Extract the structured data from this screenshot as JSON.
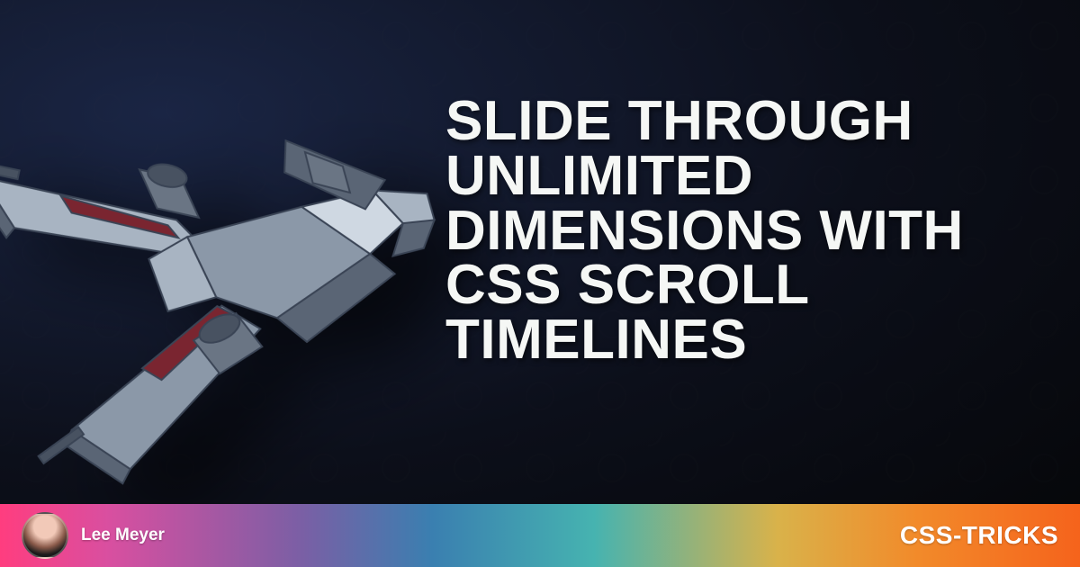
{
  "article": {
    "title": "SLIDE THROUGH UNLIMITED DIMENSIONS WITH CSS SCROLL TIMELINES"
  },
  "author": {
    "name": "Lee Meyer"
  },
  "brand": {
    "name": "CSS-TRICKS"
  },
  "illustration": {
    "name": "xwing-spaceship",
    "colors": {
      "body": "#8b98a8",
      "body_light": "#a8b4c2",
      "dark": "#5a6575",
      "stripe": "#7a2530"
    }
  },
  "footer_gradient_stops": [
    "#ff3d7f",
    "#d94fa0",
    "#7a5fa5",
    "#3a7fb0",
    "#46b3b0",
    "#d9b24a",
    "#f28a2a",
    "#f5631c"
  ],
  "background": "#0c0f1a"
}
